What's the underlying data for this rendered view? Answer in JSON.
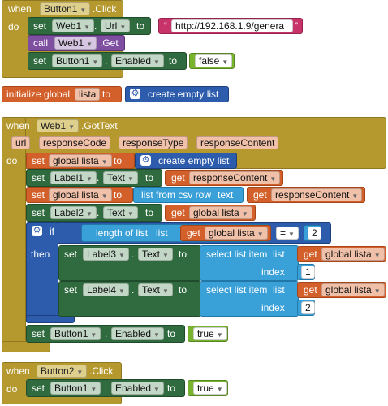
{
  "when": "when",
  "do": "do",
  "set": "set",
  "to": "to",
  "call": "call",
  "get": "get",
  "if": "if",
  "then": "then",
  "b1": {
    "component": "Button1",
    "event": ".Click",
    "web1": "Web1",
    "url_prop": "Url",
    "url_value": "http://192.168.1.9/genera",
    "get_method": ".Get",
    "button1": "Button1",
    "enabled_prop": "Enabled",
    "value": "false"
  },
  "init": {
    "label": "initialize global",
    "var": "lista",
    "to": "to",
    "create": "create empty list"
  },
  "b2": {
    "component": "Web1",
    "event": ".GotText",
    "params": [
      "url",
      "responseCode",
      "responseType",
      "responseContent"
    ],
    "s1_var": "global lista",
    "s1_val": "create empty list",
    "s2_comp": "Label1",
    "s2_prop": "Text",
    "s2_get": "responseContent",
    "s3_var": "global lista",
    "s3_fn": "list from csv row",
    "s3_text": "text",
    "s3_get": "responseContent",
    "s4_comp": "Label2",
    "s4_prop": "Text",
    "s4_get": "global lista",
    "if_len": "length of list",
    "if_list": "list",
    "if_get": "global lista",
    "if_op": "=",
    "if_num": "2",
    "t1_comp": "Label3",
    "t1_prop": "Text",
    "t1_fn": "select list item",
    "t1_list": "list",
    "t1_get": "global lista",
    "t1_index": "index",
    "t1_num": "1",
    "t2_comp": "Label4",
    "t2_prop": "Text",
    "t2_fn": "select list item",
    "t2_list": "list",
    "t2_get": "global lista",
    "t2_index": "index",
    "t2_num": "2",
    "s5_comp": "Button1",
    "s5_prop": "Enabled",
    "s5_val": "true"
  },
  "b3": {
    "component": "Button2",
    "event": ".Click",
    "s_comp": "Button1",
    "s_prop": "Enabled",
    "s_val": "true"
  }
}
